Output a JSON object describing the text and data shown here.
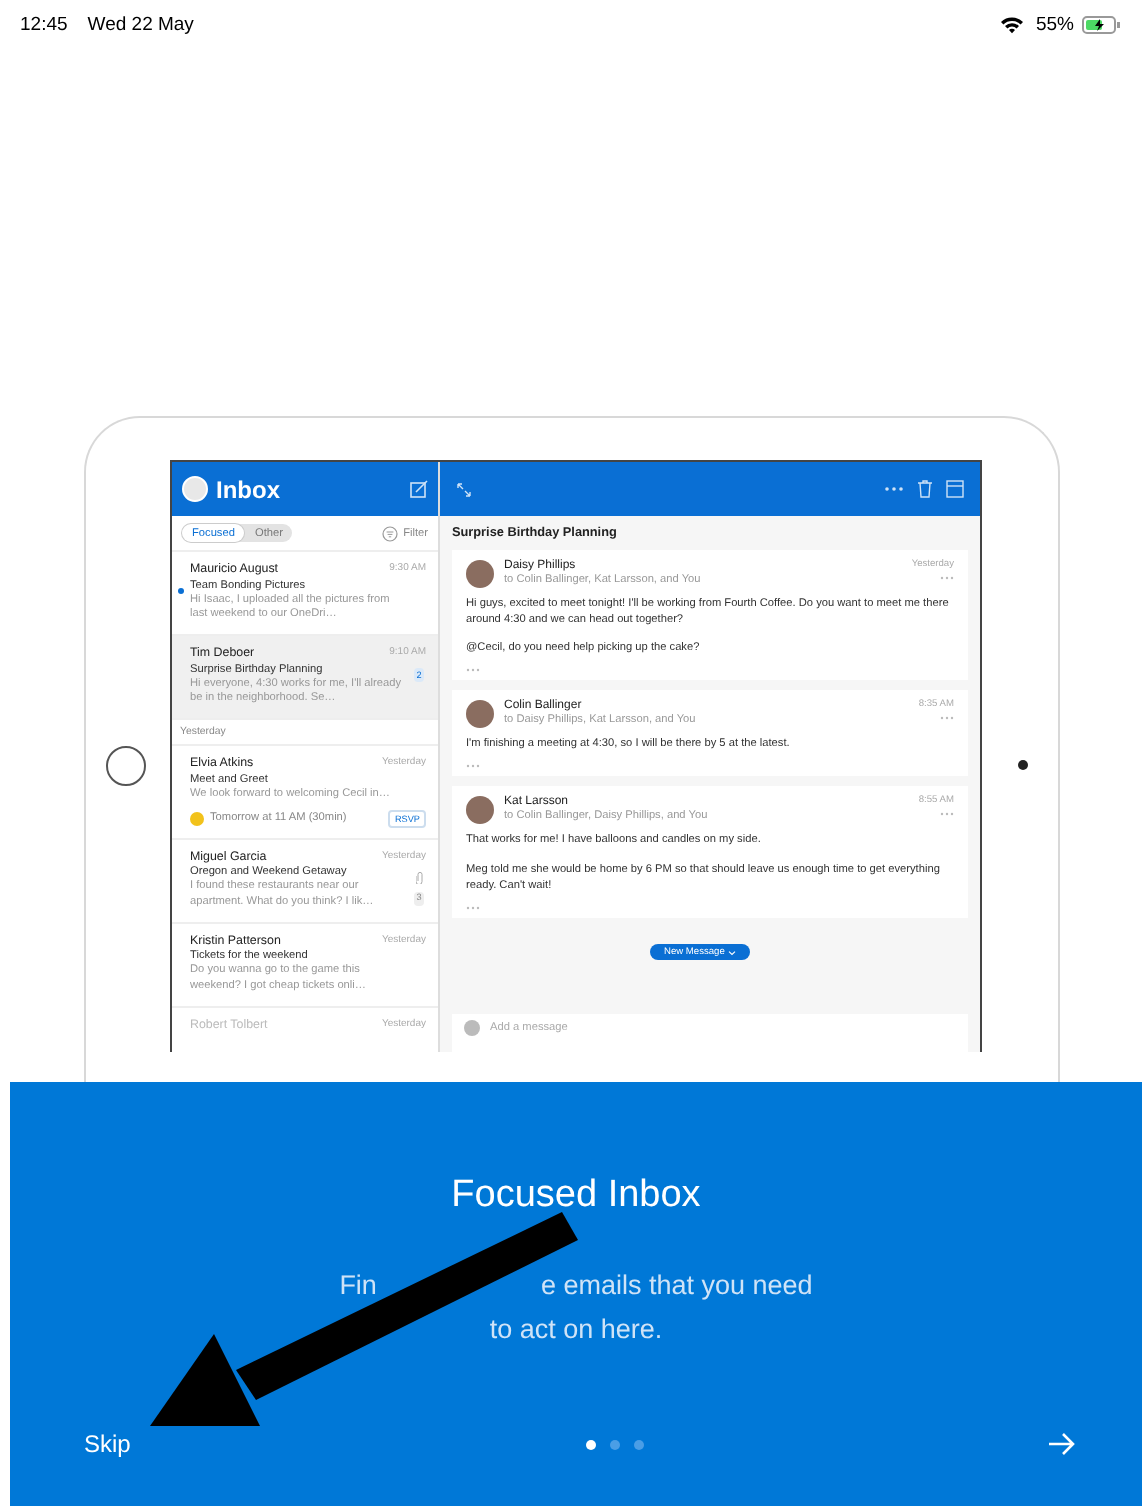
{
  "status_bar": {
    "time": "12:45",
    "date": "Wed 22 May",
    "battery": "55%"
  },
  "device_screen": {
    "inbox_pane": {
      "title": "Inbox",
      "tabs": [
        {
          "label": "Focused",
          "selected": true
        },
        {
          "label": "Other",
          "selected": false
        }
      ],
      "filter": "Filter",
      "groups": [
        {
          "messages": [
            {
              "sender": "Mauricio August",
              "time": "9:30 AM",
              "subject": "Team Bonding Pictures",
              "preview": "Hi Isaac, I uploaded all the pictures from last weekend to our OneDri…",
              "unread": true,
              "selected": false
            },
            {
              "sender": "Tim Deboer",
              "time": "9:10 AM",
              "subject": "Surprise Birthday Planning",
              "preview": "Hi everyone, 4:30 works for me, I'll already be in the neighborhood. Se…",
              "unread": false,
              "selected": true,
              "count": "2"
            }
          ]
        },
        {
          "heading": "Yesterday",
          "messages": [
            {
              "sender": "Elvia Atkins",
              "time": "Yesterday",
              "subject": "Meet and Greet",
              "preview": "We look forward to welcoming Cecil in…",
              "unread": false,
              "selected": false,
              "event": "Tomorrow at 11 AM (30min)",
              "rsvp": "RSVP"
            },
            {
              "sender": "Miguel Garcia",
              "time": "Yesterday",
              "subject": "Oregon and Weekend Getaway",
              "preview": "I found these restaurants near our apartment. What do you think? I lik…",
              "unread": false,
              "selected": false,
              "attachment": true,
              "count": "3"
            },
            {
              "sender": "Kristin Patterson",
              "time": "Yesterday",
              "subject": "Tickets for the weekend",
              "preview": "Do you wanna go to the game this weekend? I got cheap tickets onli…",
              "unread": false,
              "selected": false
            },
            {
              "sender": "Robert Tolbert",
              "time": "Yesterday",
              "unread": false,
              "selected": false
            }
          ]
        }
      ]
    },
    "reading_pane": {
      "subject": "Surprise Birthday Planning",
      "emails": [
        {
          "sender": "Daisy Phillips",
          "recipients": "to Colin Ballinger, Kat Larsson, and You",
          "time": "Yesterday",
          "body": [
            "Hi guys, excited to meet tonight! I'll be working from Fourth Coffee. Do you want to meet me there around 4:30 and we can head out together?",
            "@Cecil, do you need help picking up the cake?"
          ]
        },
        {
          "sender": "Colin Ballinger",
          "recipients": "to Daisy Phillips, Kat Larsson, and You",
          "time": "8:35 AM",
          "body": [
            "I'm finishing a meeting at 4:30, so I will be there by 5 at the latest."
          ]
        },
        {
          "sender": "Kat Larsson",
          "recipients": "to Colin Ballinger, Daisy Phillips, and You",
          "time": "8:55 AM",
          "body": [
            "That works for me! I have balloons and candles on my side.",
            "Meg told me she would be home by 6 PM so that should leave us enough time to get everything ready. Can't wait!"
          ]
        }
      ],
      "new_message_pill": "New Message",
      "compose_placeholder": "Add a message"
    }
  },
  "onboarding": {
    "title": "Focused Inbox",
    "subtitle_line_1": [
      "Fin",
      "e emails that you need"
    ],
    "subtitle_line_2": "to act on here.",
    "pages": [
      {
        "selected": true
      },
      {
        "selected": false
      },
      {
        "selected": false
      }
    ],
    "skip": "Skip"
  }
}
